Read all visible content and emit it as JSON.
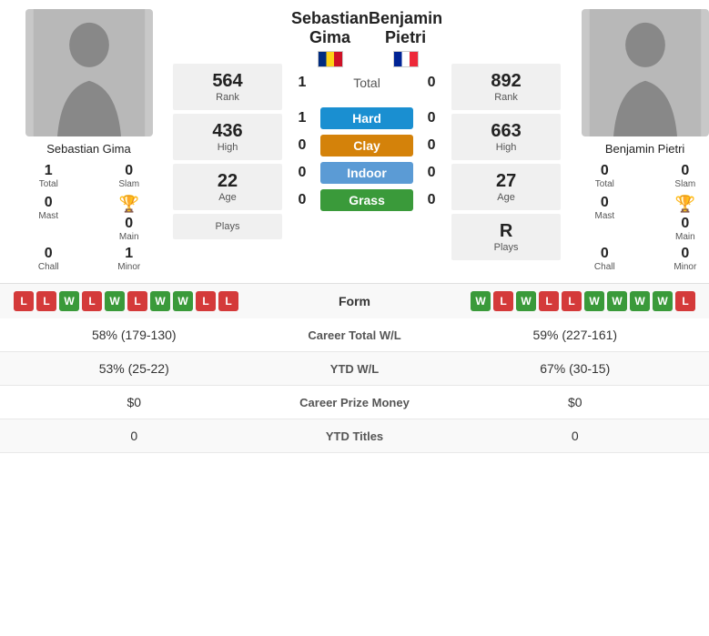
{
  "player1": {
    "name": "Sebastian Gima",
    "flag": "ro",
    "stats": {
      "rank_val": "564",
      "rank_label": "Rank",
      "high_val": "436",
      "high_label": "High",
      "age_val": "22",
      "age_label": "Age",
      "plays_val": "",
      "plays_label": "Plays"
    },
    "results": {
      "total": 1,
      "slam": 0,
      "mast": 0,
      "main": 0,
      "chall": 0,
      "minor": 1
    },
    "form": [
      "L",
      "L",
      "W",
      "L",
      "W",
      "L",
      "W",
      "W",
      "L",
      "L"
    ]
  },
  "player2": {
    "name": "Benjamin Pietri",
    "flag": "fr",
    "stats": {
      "rank_val": "892",
      "rank_label": "Rank",
      "high_val": "663",
      "high_label": "High",
      "age_val": "27",
      "age_label": "Age",
      "plays_val": "R",
      "plays_label": "Plays"
    },
    "results": {
      "total": 0,
      "slam": 0,
      "mast": 0,
      "main": 0,
      "chall": 0,
      "minor": 0
    },
    "form": [
      "W",
      "L",
      "W",
      "L",
      "L",
      "W",
      "W",
      "W",
      "W",
      "L"
    ]
  },
  "surfaces": {
    "total_label": "Total",
    "total_p1": 1,
    "total_p2": 0,
    "hard_label": "Hard",
    "hard_p1": 1,
    "hard_p2": 0,
    "clay_label": "Clay",
    "clay_p1": 0,
    "clay_p2": 0,
    "indoor_label": "Indoor",
    "indoor_p1": 0,
    "indoor_p2": 0,
    "grass_label": "Grass",
    "grass_p1": 0,
    "grass_p2": 0
  },
  "bottom_stats": {
    "career_wl_label": "Career Total W/L",
    "career_wl_p1": "58% (179-130)",
    "career_wl_p2": "59% (227-161)",
    "ytd_wl_label": "YTD W/L",
    "ytd_wl_p1": "53% (25-22)",
    "ytd_wl_p2": "67% (30-15)",
    "prize_label": "Career Prize Money",
    "prize_p1": "$0",
    "prize_p2": "$0",
    "titles_label": "YTD Titles",
    "titles_p1": "0",
    "titles_p2": "0"
  },
  "form_label": "Form"
}
